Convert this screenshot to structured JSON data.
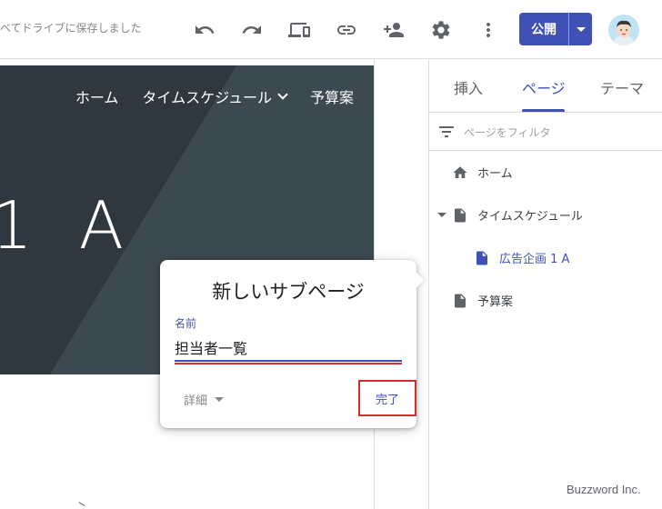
{
  "toolbar": {
    "save_status": "べてドライブに保存しました",
    "publish_label": "公開",
    "icons": [
      "undo-icon",
      "redo-icon",
      "preview-icon",
      "link-icon",
      "share-icon",
      "settings-icon",
      "more-icon"
    ]
  },
  "hero": {
    "nav": {
      "home": "ホーム",
      "schedule": "タイムスケジュール",
      "budget": "予算案"
    },
    "title": "1 A"
  },
  "sidepanel": {
    "tabs": {
      "insert": "挿入",
      "pages": "ページ",
      "themes": "テーマ"
    },
    "filter_placeholder": "ページをフィルタ",
    "pages": [
      {
        "label": "ホーム",
        "icon": "home-icon"
      },
      {
        "label": "タイムスケジュール",
        "icon": "page-icon"
      },
      {
        "label": "広告企画 1 A",
        "icon": "page-icon"
      },
      {
        "label": "予算案",
        "icon": "page-icon"
      }
    ]
  },
  "dialog": {
    "title": "新しいサブページ",
    "name_label": "名前",
    "name_value": "担当者一覧",
    "details_label": "詳細",
    "done_label": "完了"
  },
  "watermark": "Buzzword Inc.",
  "colors": {
    "accent": "#3f51b5",
    "highlight": "#d32f2f",
    "hero_bg": "#37424a"
  }
}
